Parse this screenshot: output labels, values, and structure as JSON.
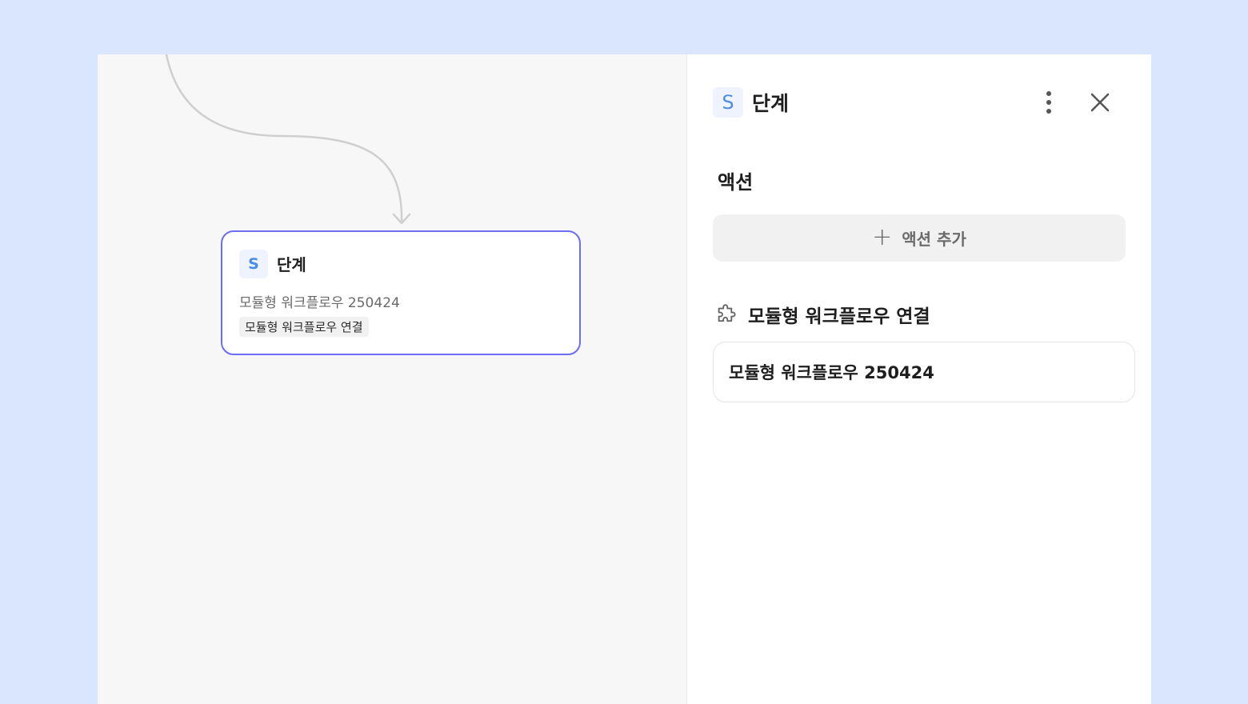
{
  "node": {
    "badge": "S",
    "title": "단계",
    "description": "모듈형 워크플로우 250424",
    "tag": "모듈형 워크플로우 연결"
  },
  "panel": {
    "badge": "S",
    "title": "단계",
    "more_icon": "more-vertical-icon",
    "close_icon": "close-icon",
    "actions_section_title": "액션",
    "add_action_label": "액션 추가",
    "module_section_icon": "puzzle-icon",
    "module_section_title": "모듈형 워크플로우 연결",
    "module_value": "모듈형 워크플로우 250424"
  },
  "colors": {
    "page_background": "#d9e6fd",
    "node_border_selected": "#6b6ef0",
    "badge_text": "#4a8de6",
    "badge_background": "#eef3fd"
  }
}
